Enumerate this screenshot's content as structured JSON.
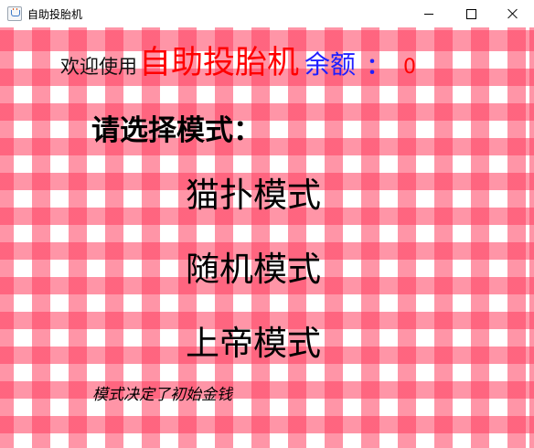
{
  "window": {
    "title": "自助投胎机",
    "icon": "java-cup-icon",
    "buttons": [
      "minimize-icon",
      "maximize-icon",
      "close-icon"
    ]
  },
  "header": {
    "welcome": "欢迎使用",
    "app_name": "自助投胎机",
    "balance_label": "余额",
    "colon": "：",
    "balance_value": "0"
  },
  "main": {
    "prompt": "请选择模式：",
    "modes": [
      {
        "label": "猫扑模式"
      },
      {
        "label": "随机模式"
      },
      {
        "label": "上帝模式"
      }
    ],
    "note": "模式决定了初始金钱"
  },
  "colors": {
    "stripe": "#ff3e5f",
    "app_name": "#ff0000",
    "balance_label": "#1f1fff",
    "balance_value": "#ff0000"
  }
}
